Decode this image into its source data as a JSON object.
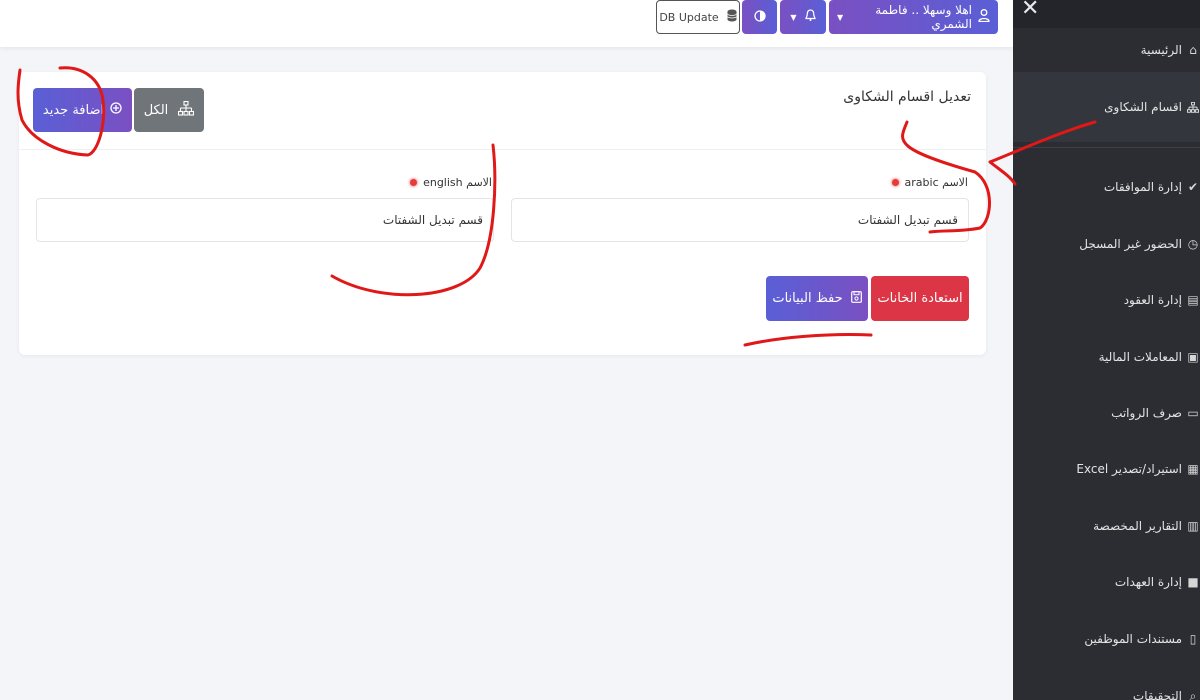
{
  "topbar": {
    "user_greeting": "اهلا وسهلا .. فاطمة الشمري",
    "db_update_label": "DB Update"
  },
  "card": {
    "title": "تعديل اقسام الشكاوى",
    "all_label": "الكل",
    "add_label": "اضافة جديد",
    "arabic_label": "الاسم arabic",
    "english_label": "الاسم english",
    "arabic_value": "قسم تبديل الشفتات",
    "english_value": "قسم تبديل الشفتات",
    "reset_label": "استعادة الخانات",
    "save_label": "حفظ البيانات"
  },
  "sidebar": {
    "items": [
      {
        "label": "الرئيسية",
        "icon": "home-icon"
      },
      {
        "label": "اقسام الشكاوى",
        "icon": "sitemap-icon"
      },
      {
        "label": "إدارة الموافقات",
        "icon": "check-circle-icon"
      },
      {
        "label": "الحضور غير المسجل",
        "icon": "clock-icon"
      },
      {
        "label": "إدارة العقود",
        "icon": "contract-icon"
      },
      {
        "label": "المعاملات المالية",
        "icon": "money-icon"
      },
      {
        "label": "صرف الرواتب",
        "icon": "wallet-icon"
      },
      {
        "label": "استيراد/تصدير Excel",
        "icon": "excel-icon"
      },
      {
        "label": "التقارير المخصصة",
        "icon": "chart-icon"
      },
      {
        "label": "إدارة العهدات",
        "icon": "box-icon"
      },
      {
        "label": "مستندات الموظفين",
        "icon": "document-icon"
      },
      {
        "label": "التحقيقات",
        "icon": "search-icon"
      }
    ]
  },
  "colors": {
    "accent_gradient_start": "#5a5fd6",
    "accent_gradient_end": "#7a50c2",
    "danger": "#dc3545",
    "sidebar_bg": "#2b2d33",
    "annotation": "#e01818"
  }
}
